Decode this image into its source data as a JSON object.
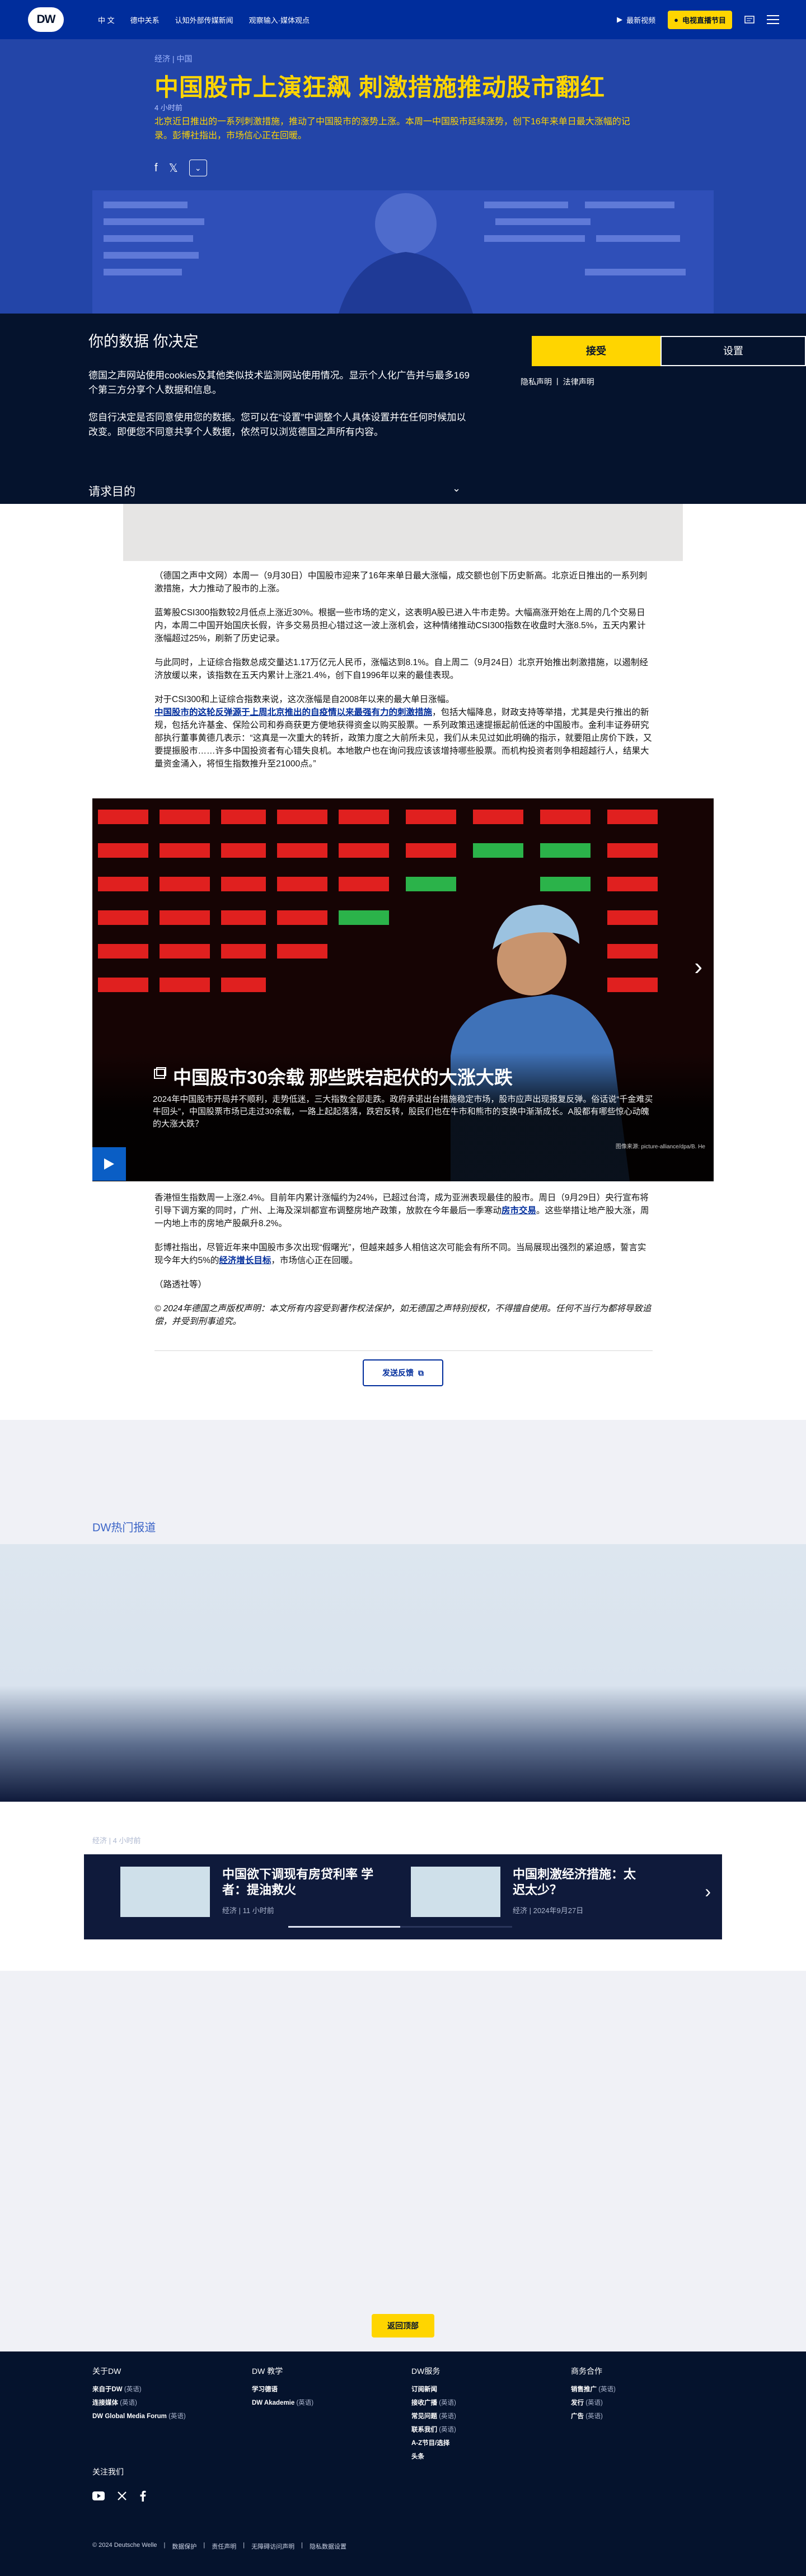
{
  "header": {
    "logo": "DW",
    "nav": [
      "中 文",
      "德中关系",
      "认知外部传媒新闻",
      "观察输入·媒体观点"
    ],
    "search": "最新视频",
    "live": "电视直播节目"
  },
  "article": {
    "kicker": "经济 | 中国",
    "title": "中国股市上演狂飙 刺激措施推动股市翻红",
    "date": "4 小时前",
    "lead": "北京近日推出的一系列刺激措施，推动了中国股市的涨势上涨。本周一中国股市延续涨势，创下16年来单日最大涨幅的记录。彭博社指出，市场信心正在回暖。",
    "paragraphs": [
      {
        "text": "（德国之声中文网）本周一（9月30日）中国股市迎来了16年来单日最大涨幅，成交额也创下历史新高。北京近日推出的一系列刺激措施，大力推动了股市的上涨。"
      },
      {
        "text": "蓝筹股CSI300指数较2月低点上涨近30%。根据一些市场的定义，这表明A股已进入牛市走势。大幅高涨开始在上周的几个交易日内，本周二中国开始国庆长假，许多交易员担心错过这一波上涨机会，这种情绪推动CSI300指数在收盘时大涨8.5%，五天内累计涨幅超过25%，刷新了历史记录。"
      },
      {
        "text": "与此同时，上证综合指数总成交量达1.17万亿元人民币，涨幅达到8.1%。自上周二（9月24日）北京开始推出刺激措施，以遏制经济放缓以来，该指数在五天内累计上涨21.4%，创下自1996年以来的最佳表现。"
      },
      {
        "pre": "对于CSI300和上证综合指数来说，这次涨幅是自2008年以来的最大单日涨幅。",
        "link": "中国股市的这轮反弹源于上周北京推出的自疫情以来最强有力的刺激措施",
        "post": "，包括大幅降息，财政支持等举措，尤其是央行推出的新规，包括允许基金、保险公司和券商获更方便地获得资金以购买股票。一系列政策迅速提振起前低迷的中国股市。金利丰证券研究部执行董事黄德几表示：“这真是一次重大的转折，政策力度之大前所未见，我们从未见过如此明确的指示，就要阻止房价下跌，又要提振股市……许多中国投资者有心错失良机。本地散户也在询问我应该该增持哪些股票。而机构投资者则争相超越行人，结果大量资金涌入，将恒生指数推升至21000点。”"
      }
    ]
  },
  "gallery": {
    "title": "中国股市30余载 那些跌宕起伏的大涨大跌",
    "desc": "2024年中国股市开局并不顺利，走势低迷，三大指数全部走跌。政府承诺出台措施稳定市场，股市应声出现报复反弹。俗话说“千金难买牛回头”，中国股票市场已走过30余载，一路上起起落落，跌宕反转，股民们也在牛市和熊市的变换中渐渐成长。A股都有哪些惊心动魄的大涨大跌？",
    "credit": "图像来源: picture-alliance/dpa/B. He"
  },
  "after": {
    "p1pre": "香港恒生指数周一上涨2.4%。目前年内累计涨幅约为24%，已超过台湾，成为亚洲表现最佳的股市。周日（9月29日）央行宣布将引导下调方案的同时，广州、上海及深圳都宣布调整房地产政策，放款在今年最后一季寒动",
    "p1link": "房市交易",
    "p1post": "。这些举措让地产股大涨，周一内地上市的房地产股飙升8.2%。",
    "p2pre": "彭博社指出，尽管近年来中国股市多次出现“假曙光”，但越来越多人相信这次可能会有所不同。当局展现出强烈的紧迫感，誓言实现今年大约5%的",
    "p2link": "经济增长目标",
    "p2post": "，市场信心正在回暖。",
    "source": "（路透社等）",
    "copy": "© 2024年德国之声版权声明：本文所有内容受到著作权法保护，如无德国之声特别授权，不得擅自使用。任何不当行为都将导致追偿，并受到刑事追究。",
    "feedback": "发送反馈"
  },
  "consent": {
    "title": "你的数据 你决定",
    "p1": "德国之声网站使用cookies及其他类似技术监测网站使用情况。显示个人化广告并与最多169 个第三方分享个人数据和信息。",
    "p2": "您自行决定是否同意使用您的数据。您可以在“设置”中调整个人具体设置并在任何时候加以改变。即便您不同意共享个人数据，依然可以浏览德国之声所有内容。",
    "purpose": "请求目的",
    "accept": "接受",
    "settings": "设置",
    "privacy": "隐私声明",
    "legal": "法律声明"
  },
  "hot": {
    "label": "DW热门报道",
    "feature_title": "中国股市上演狂飙 刺激措施推动股市翻红",
    "feature_meta": "经济 | 4 小时前",
    "cards": [
      {
        "title": "中国欲下调现有房贷利率 学者：提油救火",
        "meta": "经济 | 11 小时前"
      },
      {
        "title": "中国刺激经济措施：太迟太少？",
        "meta": "经济 | 2024年9月27日"
      }
    ]
  },
  "footer": {
    "totop": "返回顶部",
    "cols": [
      {
        "title": "关于DW",
        "items": [
          {
            "t": "来自于DW",
            "s": "(英语)"
          },
          {
            "t": "连接媒体",
            "s": "(英语)"
          },
          {
            "t": "DW Global Media Forum",
            "s": "(英语)"
          }
        ]
      },
      {
        "title": "DW 教学",
        "items": [
          {
            "t": "学习德语",
            "s": ""
          },
          {
            "t": "DW Akademie",
            "s": "(英语)"
          }
        ]
      },
      {
        "title": "DW服务",
        "items": [
          {
            "t": "订阅新闻",
            "s": ""
          },
          {
            "t": "接收广播",
            "s": "(英语)"
          },
          {
            "t": "常见问题",
            "s": "(英语)"
          },
          {
            "t": "联系我们",
            "s": "(英语)"
          },
          {
            "t": "A-Z节目/选择",
            "s": ""
          },
          {
            "t": "头条",
            "s": ""
          }
        ]
      },
      {
        "title": "商务合作",
        "items": [
          {
            "t": "销售推广",
            "s": "(英语)"
          },
          {
            "t": "发行",
            "s": "(英语)"
          },
          {
            "t": "广告",
            "s": "(英语)"
          }
        ]
      }
    ],
    "follow": "关注我们",
    "bottom": [
      "© 2024 Deutsche Welle",
      "数据保护",
      "责任声明",
      "无障碍访问声明",
      "隐私数据设置"
    ]
  },
  "colors": {
    "dw_blue": "#002d9c",
    "yellow": "#ffd500",
    "dark": "#05132d"
  }
}
